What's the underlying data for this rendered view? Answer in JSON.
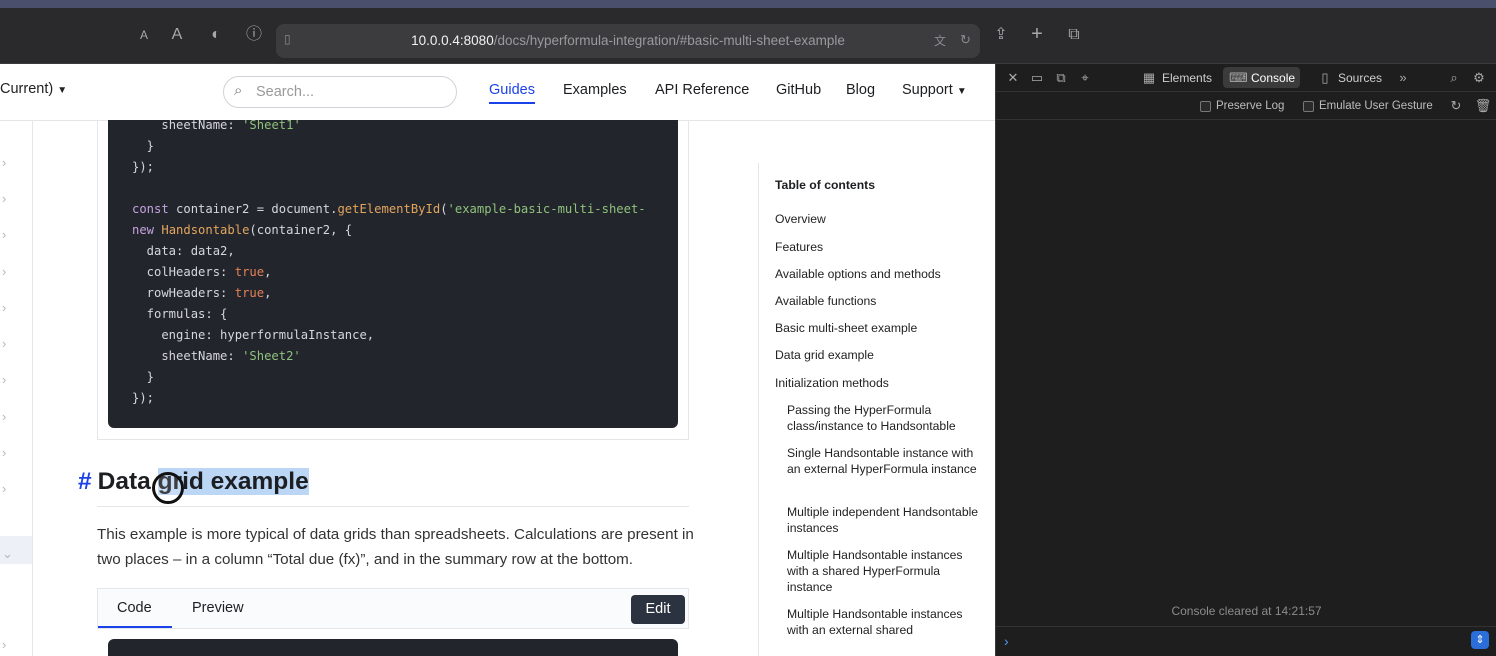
{
  "browser": {
    "url_host": "10.0.0.4:8080",
    "url_path": "/docs/hyperformula-integration/#basic-multi-sheet-example"
  },
  "navbar": {
    "version": "Current)",
    "search_placeholder": "Search...",
    "links": [
      "Guides",
      "Examples",
      "API Reference",
      "GitHub",
      "Blog",
      "Support"
    ]
  },
  "code_block_1": {
    "lines": [
      "    sheetName: 'Sheet1'",
      "  }",
      "});",
      "",
      "const container2 = document.getElementById('example-basic-multi-sheet-",
      "new Handsontable(container2, {",
      "  data: data2,",
      "  colHeaders: true,",
      "  rowHeaders: true,",
      "  formulas: {",
      "    engine: hyperformulaInstance,",
      "    sheetName: 'Sheet2'",
      "  }",
      "});"
    ]
  },
  "section": {
    "hash": "#",
    "heading_before": "Data ",
    "heading_selected": "grid example",
    "paragraph": "This example is more typical of data grids than spreadsheets. Calculations are present in two places – in a column “Total due (fx)”, and in the summary row at the bottom."
  },
  "tabs": {
    "code": "Code",
    "preview": "Preview",
    "edit": "Edit"
  },
  "toc": {
    "title": "Table of contents",
    "items": [
      "Overview",
      "Features",
      "Available options and methods",
      "Available functions",
      "Basic multi-sheet example",
      "Data grid example",
      "Initialization methods"
    ],
    "subitems": [
      "Passing the HyperFormula class/instance to Handsontable",
      "Single Handsontable instance with an external HyperFormula instance",
      "Multiple independent Handsontable instances",
      "Multiple Handsontable instances with a shared HyperFormula instance",
      "Multiple Handsontable instances with an external shared HyperFormula instance"
    ]
  },
  "devtools": {
    "tabs": [
      "Elements",
      "Console",
      "Sources"
    ],
    "preserve_log": "Preserve Log",
    "emulate_gesture": "Emulate User Gesture",
    "cleared_message": "Console cleared at 14:21:57"
  },
  "colors": {
    "accent": "#1a42e8",
    "code_bg": "#22252c",
    "selection": "#bcd6f6"
  }
}
